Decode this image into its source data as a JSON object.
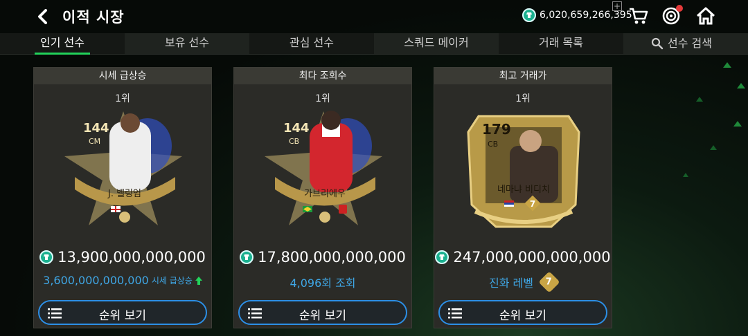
{
  "header": {
    "title": "이적 시장",
    "currency_value": "6,020,659,266,395"
  },
  "tabs": [
    {
      "label": "인기 선수",
      "active": true
    },
    {
      "label": "보유 선수",
      "active": false
    },
    {
      "label": "관심 선수",
      "active": false
    },
    {
      "label": "스쿼드 메이커",
      "active": false
    },
    {
      "label": "거래 목록",
      "active": false
    },
    {
      "label": "선수 검색",
      "active": false
    }
  ],
  "cards": [
    {
      "heading": "시세 급상승",
      "rank": "1위",
      "player": {
        "ovr": "144",
        "pos": "CM",
        "name": "J. 벨링엄"
      },
      "price": "13,900,000,000,000",
      "sub_value": "3,600,000,000,000",
      "sub_label": "시세 급상승",
      "button": "순위 보기"
    },
    {
      "heading": "최다 조회수",
      "rank": "1위",
      "player": {
        "ovr": "144",
        "pos": "CB",
        "name": "가브리에우"
      },
      "price": "17,800,000,000,000",
      "sub_value": "4,096회 조회",
      "button": "순위 보기"
    },
    {
      "heading": "최고 거래가",
      "rank": "1위",
      "player": {
        "ovr": "179",
        "pos": "CB",
        "name": "네마냐 비디치",
        "level": "7"
      },
      "price": "247,000,000,000,000",
      "sub_value": "진화 레벨",
      "level_badge": "7",
      "button": "순위 보기"
    }
  ],
  "colors": {
    "accent_green": "#22d35b",
    "button_border": "#2c8fe6",
    "link_blue": "#3fa7e6"
  }
}
